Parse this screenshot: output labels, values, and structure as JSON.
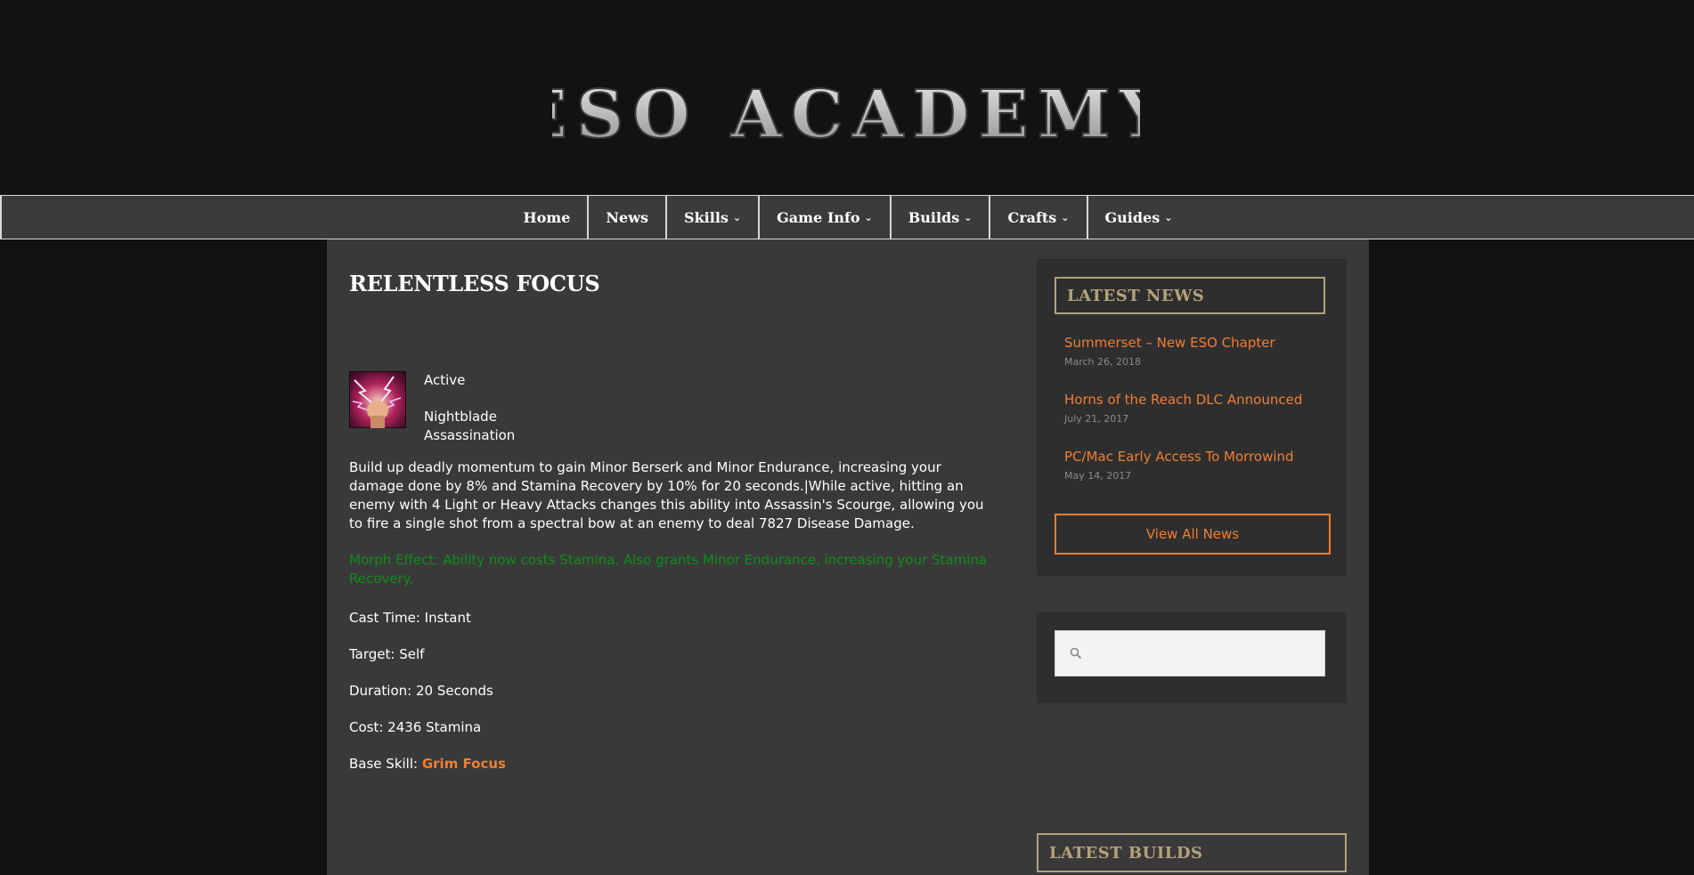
{
  "site": {
    "logo_text": "ESO ACADEMY"
  },
  "nav": {
    "items": [
      {
        "label": "Home",
        "dropdown": false
      },
      {
        "label": "News",
        "dropdown": false
      },
      {
        "label": "Skills",
        "dropdown": true
      },
      {
        "label": "Game Info",
        "dropdown": true
      },
      {
        "label": "Builds",
        "dropdown": true
      },
      {
        "label": "Crafts",
        "dropdown": true
      },
      {
        "label": "Guides",
        "dropdown": true
      }
    ],
    "chevron": "⌄"
  },
  "skill": {
    "title": "RELENTLESS FOCUS",
    "icon": "skill-icon-relentless-focus",
    "type": "Active",
    "class": "Nightblade",
    "skill_line": "Assassination",
    "description": "Build up deadly momentum to gain Minor Berserk and Minor Endurance, increasing your damage done by 8% and Stamina Recovery by 10% for 20 seconds.|While active, hitting an enemy with 4 Light or Heavy Attacks changes this ability into Assassin's Scourge, allowing you to fire a single shot from a spectral bow at an enemy to deal 7827 Disease Damage.",
    "morph_effect": "Morph Effect: Ability now costs Stamina. Also grants Minor Endurance, increasing your Stamina Recovery.",
    "cast_time": "Cast Time: Instant",
    "target": "Target: Self",
    "duration": "Duration: 20 Seconds",
    "cost": "Cost: 2436 Stamina",
    "base_skill_label": "Base Skill:",
    "base_skill_link": "Grim Focus"
  },
  "sidebar": {
    "latest_news": {
      "title": "LATEST NEWS",
      "items": [
        {
          "title": "Summerset – New ESO Chapter",
          "date": "March 26, 2018"
        },
        {
          "title": "Horns of the Reach DLC Announced",
          "date": "July 21, 2017"
        },
        {
          "title": "PC/Mac Early Access To Morrowind",
          "date": "May 14, 2017"
        }
      ],
      "view_all": "View All News"
    },
    "search": {
      "placeholder": "",
      "value": ""
    },
    "latest_builds": {
      "title": "LATEST BUILDS"
    }
  },
  "colors": {
    "background": "#121212",
    "panel": "#3a393a",
    "nav": "#3c3b3c",
    "accent": "#ee7e32",
    "gold": "#b3a27a",
    "morph_green": "#0f8d18"
  }
}
